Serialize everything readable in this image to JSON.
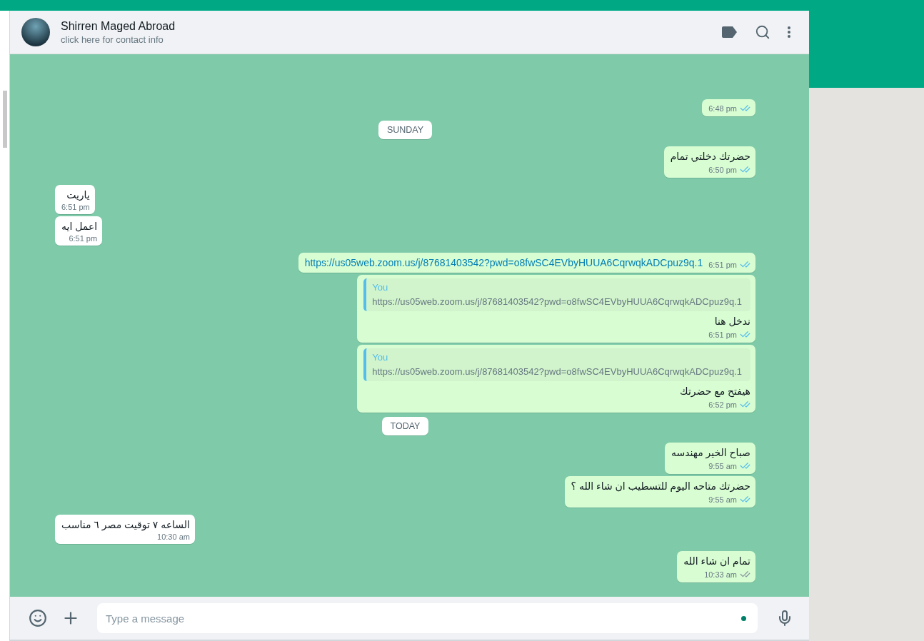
{
  "header": {
    "contact_name": "Shirren Maged Abroad",
    "contact_status": "click here for contact info"
  },
  "messages": [
    {
      "kind": "outgoing",
      "time": "6:48 pm",
      "read": true
    },
    {
      "kind": "divider",
      "text": "SUNDAY"
    },
    {
      "kind": "outgoing",
      "text": "حضرتك دخلتي تمام",
      "time": "6:50 pm",
      "read": true
    },
    {
      "kind": "incoming",
      "text": "ياريت",
      "time": "6:51 pm"
    },
    {
      "kind": "incoming",
      "text": "اعمل ايه",
      "time": "6:51 pm"
    },
    {
      "kind": "outgoing",
      "text": "https://us05web.zoom.us/j/87681403542?pwd=o8fwSC4EVbyHUUA6CqrwqkADCpuz9q.1",
      "time": "6:51 pm",
      "read": true,
      "link": true
    },
    {
      "kind": "outgoing",
      "quote": {
        "author": "You",
        "text": "https://us05web.zoom.us/j/87681403542?pwd=o8fwSC4EVbyHUUA6CqrwqkADCpuz9q.1"
      },
      "text": "ندخل هنا",
      "time": "6:51 pm",
      "read": true
    },
    {
      "kind": "outgoing",
      "quote": {
        "author": "You",
        "text": "https://us05web.zoom.us/j/87681403542?pwd=o8fwSC4EVbyHUUA6CqrwqkADCpuz9q.1"
      },
      "text": "هيفتح مع حضرتك",
      "time": "6:52 pm",
      "read": true
    },
    {
      "kind": "divider",
      "text": "TODAY"
    },
    {
      "kind": "outgoing",
      "text": "صباح الخير مهندسه",
      "time": "9:55 am",
      "read": true
    },
    {
      "kind": "outgoing",
      "text": "حضرتك متاحه اليوم للتسطيب ان شاء الله ؟",
      "time": "9:55 am",
      "read": true
    },
    {
      "kind": "incoming",
      "text": "الساعه ٧ توقيت مصر ٦ مناسب",
      "time": "10:30 am"
    },
    {
      "kind": "outgoing",
      "text": "تمام ان شاء الله",
      "time": "10:33 am",
      "read": false
    }
  ],
  "composer": {
    "placeholder": "Type a message"
  }
}
